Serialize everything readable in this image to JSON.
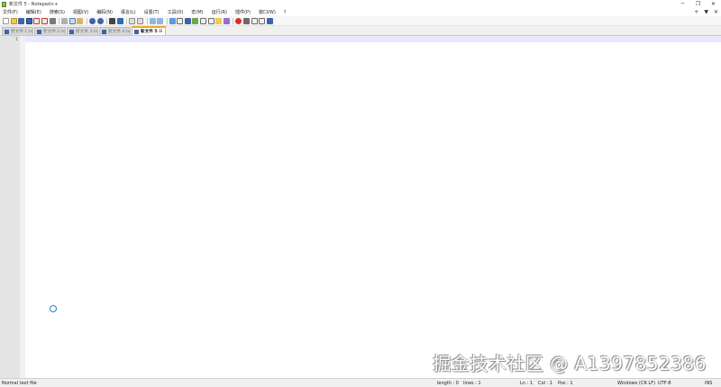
{
  "window": {
    "title": "新文件 5 - Notepad++",
    "controls": {
      "minimize": "─",
      "maximize": "❐",
      "close": "✕"
    }
  },
  "menu": {
    "items": [
      "文件(F)",
      "编辑(E)",
      "搜索(S)",
      "视图(V)",
      "编码(N)",
      "语言(L)",
      "设置(T)",
      "工具(O)",
      "宏(M)",
      "运行(R)",
      "插件(P)",
      "窗口(W)",
      "?"
    ],
    "right": [
      "+",
      "▼",
      "✕"
    ]
  },
  "toolbar": {
    "icons": [
      "new-file",
      "open-file",
      "save",
      "save-all",
      "close",
      "close-all",
      "print",
      "cut",
      "copy",
      "paste",
      "undo",
      "redo",
      "find",
      "replace",
      "zoom-in",
      "zoom-out",
      "sync-vertical",
      "sync-horizontal",
      "word-wrap",
      "show-all-chars",
      "indent-guide",
      "user-defined-language",
      "document-map",
      "function-list",
      "folder-as-workspace",
      "monitoring",
      "record-macro",
      "stop-recording",
      "playback-macro",
      "run-macro-multiple",
      "save-macro"
    ]
  },
  "tabs": [
    {
      "label": "新文件 1.txt",
      "active": false
    },
    {
      "label": "新文件 2.txt",
      "active": false
    },
    {
      "label": "新文件 3.txt",
      "active": false
    },
    {
      "label": "新文件 4.txt",
      "active": false
    },
    {
      "label": "新文件 5 ☒",
      "active": true
    }
  ],
  "editor": {
    "line_numbers": [
      "1"
    ],
    "content": ""
  },
  "watermark": "掘金技术社区 @ A1397852386",
  "status": {
    "file_type": "Normal text file",
    "length": "length : 0",
    "lines": "lines : 1",
    "ln": "Ln : 1",
    "col": "Col : 1",
    "pos": "Pos : 1",
    "eol": "Windows (CR LF)",
    "encoding": "UTF-8",
    "mode": "INS"
  },
  "colors": {
    "accent_tab": "#f5a623",
    "current_line": "#e8e8ff",
    "busy_cursor": "#1a86c5"
  }
}
